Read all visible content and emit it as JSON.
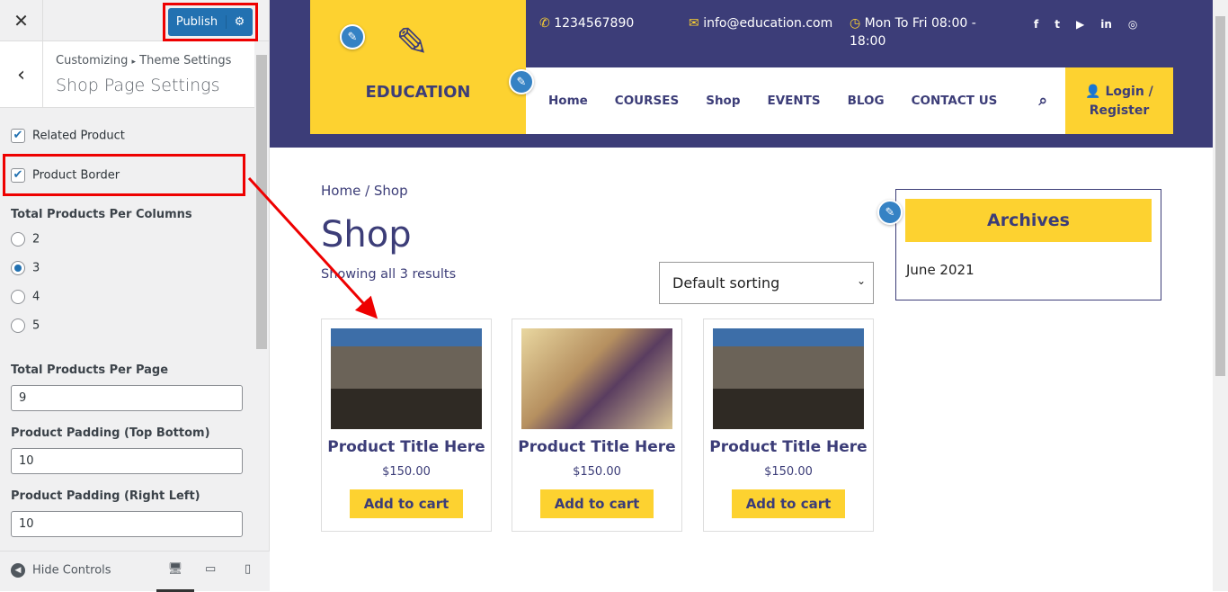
{
  "customizer": {
    "close_icon": "close-icon",
    "publish": "Publish",
    "settings_icon": "gear-icon",
    "breadcrumb_root": "Customizing",
    "breadcrumb_sep": "▸",
    "breadcrumb_section": "Theme Settings",
    "title": "Shop Page Settings",
    "related_product": {
      "label": "Related Product",
      "checked": true
    },
    "product_border": {
      "label": "Product Border",
      "checked": true
    },
    "columns": {
      "label": "Total Products Per Columns",
      "options": [
        "2",
        "3",
        "4",
        "5"
      ],
      "selected": "3"
    },
    "per_page": {
      "label": "Total Products Per Page",
      "value": "9"
    },
    "padding_tb": {
      "label": "Product Padding (Top Bottom)",
      "value": "10"
    },
    "padding_rl": {
      "label": "Product Padding (Right Left)",
      "value": "10"
    },
    "hide_controls": "Hide Controls",
    "accent": "#2271b1"
  },
  "site": {
    "brand": "EDUCATION",
    "phone": "1234567890",
    "email": "info@education.com",
    "hours": "Mon To Fri 08:00 - 18:00",
    "social": [
      "f",
      "t",
      "▶",
      "in",
      "◎"
    ],
    "nav": [
      "Home",
      "COURSES",
      "Shop",
      "EVENTS",
      "BLOG",
      "CONTACT US"
    ],
    "login": "Login / Register",
    "breadcrumb": "Home / Shop",
    "page_title": "Shop",
    "result_count": "Showing all 3 results",
    "sorting": "Default sorting",
    "products": [
      {
        "title": "Product Title Here",
        "price": "$150.00",
        "button": "Add to cart"
      },
      {
        "title": "Product Title Here",
        "price": "$150.00",
        "button": "Add to cart"
      },
      {
        "title": "Product Title Here",
        "price": "$150.00",
        "button": "Add to cart"
      }
    ],
    "archives": {
      "title": "Archives",
      "items": [
        "June 2021"
      ]
    },
    "colors": {
      "navy": "#3c3d78",
      "yellow": "#fdd230"
    }
  }
}
